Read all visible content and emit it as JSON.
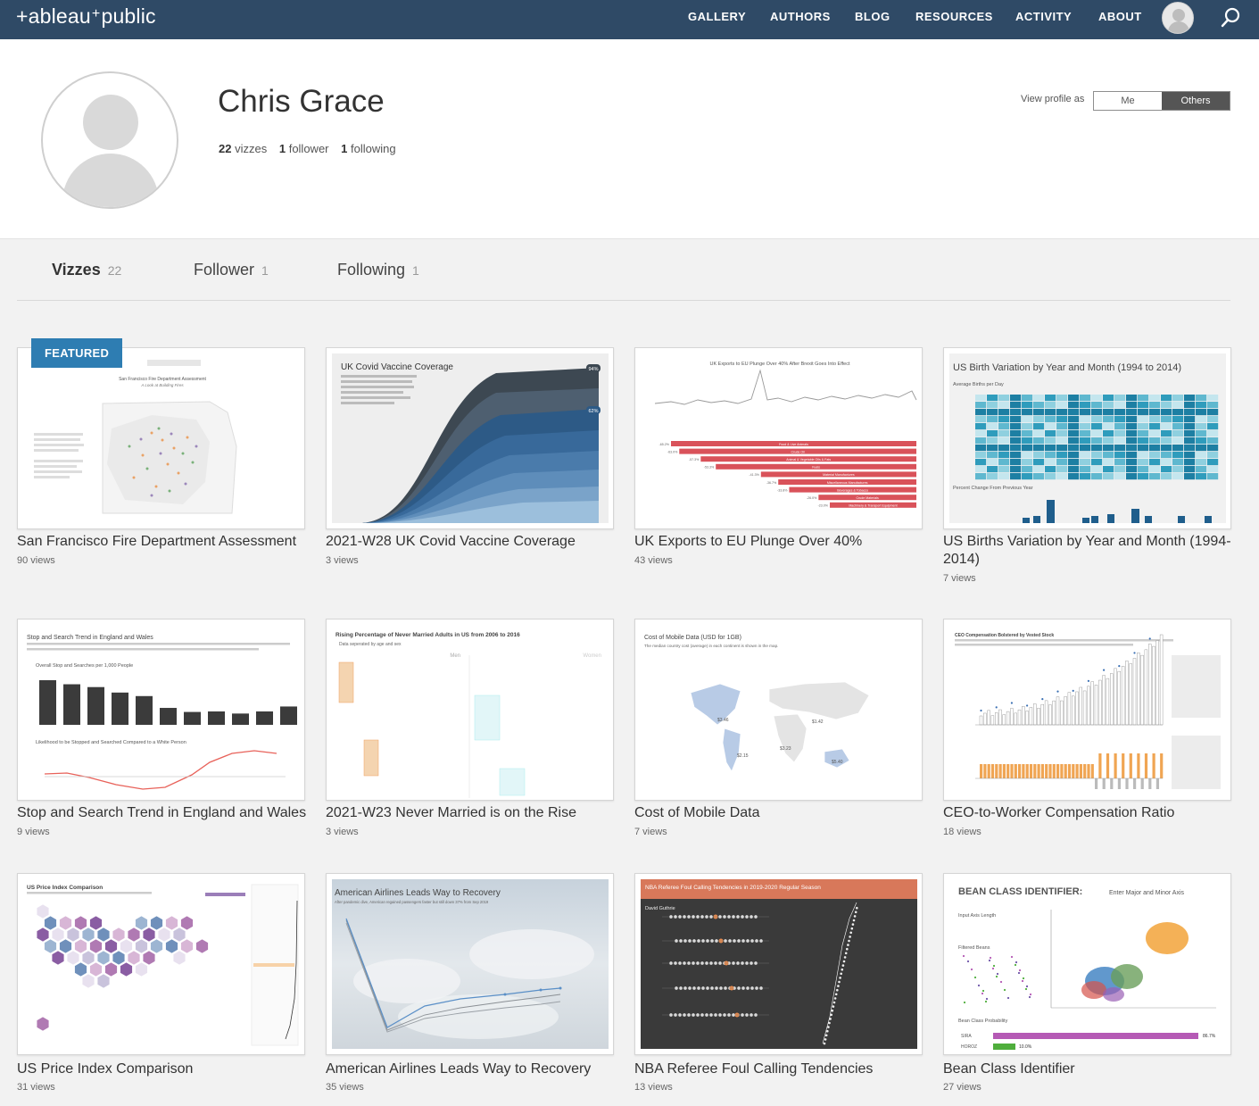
{
  "brand": {
    "logo_left": "+ableau",
    "logo_right": "public"
  },
  "nav": {
    "items": [
      "GALLERY",
      "AUTHORS",
      "BLOG",
      "RESOURCES",
      "ACTIVITY",
      "ABOUT"
    ]
  },
  "profile": {
    "name": "Chris Grace",
    "vizzes_count": "22",
    "vizzes_label": "vizzes",
    "followers_count": "1",
    "followers_label": "follower",
    "following_count": "1",
    "following_label": "following",
    "view_as_label": "View profile as",
    "view_as_options": [
      "Me",
      "Others"
    ],
    "view_as_selected": "Others"
  },
  "tabs": [
    {
      "label": "Vizzes",
      "count": "22",
      "active": true
    },
    {
      "label": "Follower",
      "count": "1",
      "active": false
    },
    {
      "label": "Following",
      "count": "1",
      "active": false
    }
  ],
  "featured_label": "FEATURED",
  "vizzes": [
    {
      "title": "San Francisco Fire Department Assessment",
      "views": "90 views",
      "thumb_title": "San Francisco Fire Department Assessment",
      "thumb_subtitle": "A Look at Building Fires"
    },
    {
      "title": "2021-W28 UK Covid Vaccine Coverage",
      "views": "3 views",
      "thumb_title": "UK Covid Vaccine Coverage",
      "thumb_badge_1": "94%",
      "thumb_badge_2": "62%"
    },
    {
      "title": "UK Exports to EU Plunge Over 40%",
      "views": "43 views",
      "thumb_title": "UK Exports to EU Plunge Over 40% After Brexit Goes Into Effect",
      "thumb_bar_labels": [
        "Food & Live Animals",
        "Crude Oil",
        "Animal & Vegetable Oils & Fats",
        "Fuels",
        "Material Manufactures",
        "Miscellaneous Manufactures",
        "Beverages & Tobacco",
        "Crude Materials",
        "Machinery & Transport Equipment"
      ],
      "thumb_bar_values": [
        "-65.2%",
        "-63.0%",
        "-57.3%",
        "-53.3%",
        "-41.3%",
        "-36.7%",
        "-33.8%",
        "-26.0%",
        "-23.0%"
      ]
    },
    {
      "title": "US Births Variation by Year and Month (1994-2014)",
      "views": "7 views",
      "thumb_title": "US Birth Variation by Year and Month (1994 to 2014)",
      "thumb_sub1": "Average Births per Day",
      "thumb_sub2": "Percent Change From Previous Year"
    },
    {
      "title": "Stop and Search Trend in England and Wales",
      "views": "9 views",
      "thumb_title": "Stop and Search Trend in England and Wales",
      "thumb_sub1": "Overall Stop and Searches per 1,000 People",
      "thumb_sub2": "Likelihood to be Stopped and Searched Compared to a White Person",
      "thumb_bars": [
        25.3,
        23.0,
        21.4,
        18.3,
        16.3,
        9.6,
        7.3,
        7.6,
        6.4,
        7.6,
        10.4
      ]
    },
    {
      "title": "2021-W23 Never Married is on the Rise",
      "views": "3 views",
      "thumb_title": "Rising Percentage of Never Married Adults in US from 2006 to 2016",
      "thumb_sub": "Data seperated by age and sex",
      "thumb_col1": "Men",
      "thumb_col2": "Women"
    },
    {
      "title": "Cost of Mobile Data",
      "views": "7 views",
      "thumb_title": "Cost of Mobile Data (USD for 1GB)",
      "thumb_sub": "The median country cost (average) in each continent is shown in the map.",
      "thumb_prices": [
        "$3.46",
        "$1.42",
        "$3.23",
        "$2.15",
        "$5.40"
      ]
    },
    {
      "title": "CEO-to-Worker Compensation Ratio",
      "views": "18 views",
      "thumb_title": "CEO Compensation Bolstered by Vested Stock"
    },
    {
      "title": "US Price Index Comparison",
      "views": "31 views",
      "thumb_title": "US Price Index Comparison"
    },
    {
      "title": "American Airlines Leads Way to Recovery",
      "views": "35 views",
      "thumb_title": "American Airlines Leads Way to Recovery",
      "thumb_sub": "After pandemic dive, American regained passengers faster but still down 37% from Sep 2019"
    },
    {
      "title": "NBA Referee Foul Calling Tendencies",
      "views": "13 views",
      "thumb_title": "NBA Referee Foul Calling Tendencies in 2019-2020 Regular Season",
      "thumb_name": "David Guthrie"
    },
    {
      "title": "Bean Class Identifier",
      "views": "27 views",
      "thumb_title": "BEAN CLASS IDENTIFIER:",
      "thumb_title2": "Enter Major and Minor Axis",
      "thumb_sub1": "Input Axis Length",
      "thumb_sub2": "Filtered Beans",
      "thumb_sub3": "Bean Class Probability",
      "thumb_prob": [
        {
          "name": "SIRA",
          "value": "86.7%"
        },
        {
          "name": "HOROZ",
          "value": "10.0%"
        }
      ]
    }
  ]
}
